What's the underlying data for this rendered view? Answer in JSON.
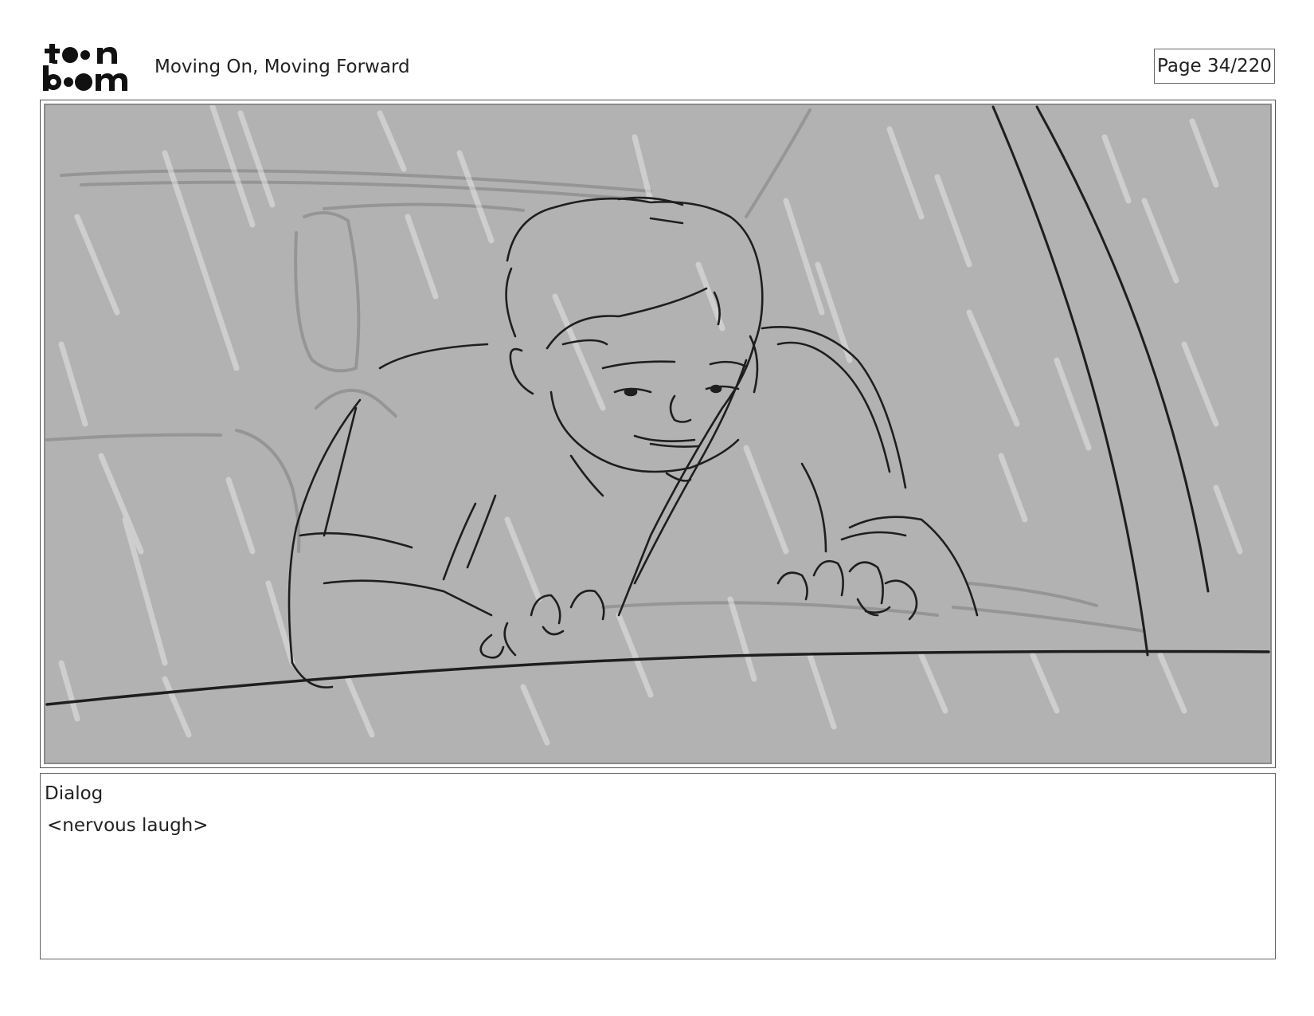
{
  "header": {
    "logo_text": "toon boom",
    "title": "Moving On, Moving Forward",
    "page_indicator": "Page  34/220"
  },
  "panel": {
    "background_color": "#b2b2b2",
    "line_color": "#1e1e1e"
  },
  "dialog": {
    "label": "Dialog",
    "text": "<nervous laugh>"
  }
}
